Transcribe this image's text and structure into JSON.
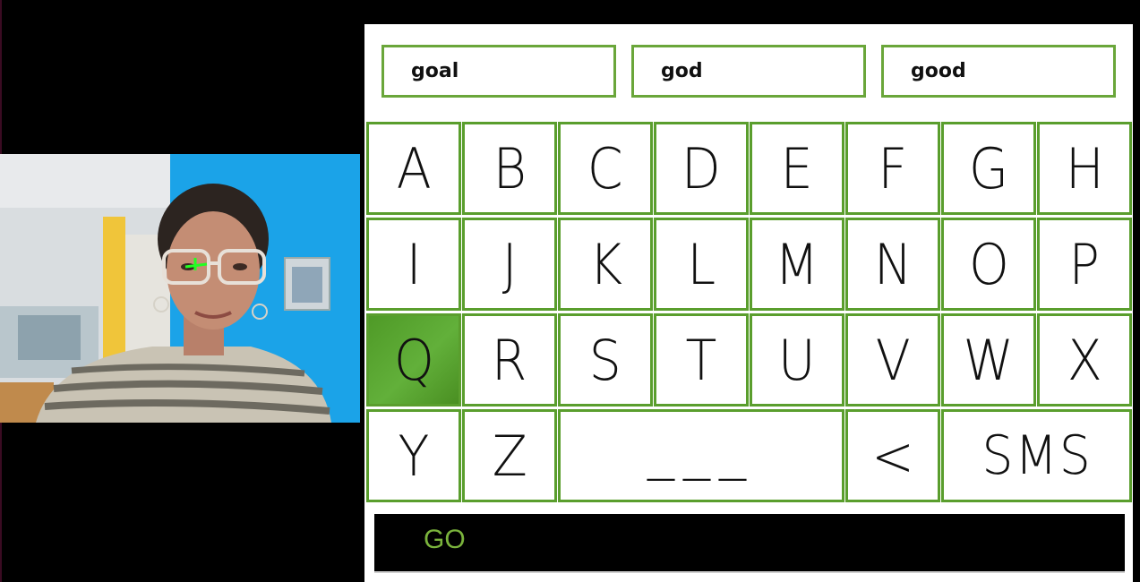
{
  "suggestions": [
    "goal",
    "god",
    "good"
  ],
  "keys": {
    "row1": [
      "A",
      "B",
      "C",
      "D",
      "E",
      "F",
      "G",
      "H"
    ],
    "row2": [
      "I",
      "J",
      "K",
      "L",
      "M",
      "N",
      "O",
      "P"
    ],
    "row3": [
      "Q",
      "R",
      "S",
      "T",
      "U",
      "V",
      "W",
      "X"
    ],
    "row4": [
      "Y",
      "Z",
      "___",
      "<",
      "SMS"
    ]
  },
  "selected_key": "Q",
  "go_label": "GO",
  "colors": {
    "accent": "#5a9e2d",
    "go_text": "#7ab33c",
    "background": "#000000"
  }
}
